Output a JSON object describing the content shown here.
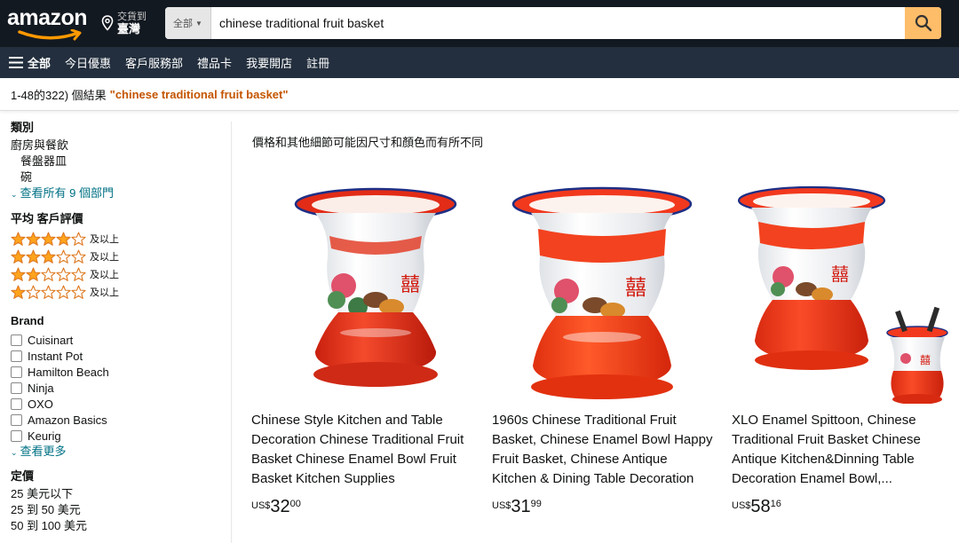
{
  "header": {
    "logo_text": "amazon",
    "deliver_line1": "交貨到",
    "deliver_line2": "臺灣",
    "search_scope": "全部",
    "search_value": "chinese traditional fruit basket"
  },
  "nav": {
    "all_label": "全部",
    "items": [
      "今日優惠",
      "客戶服務部",
      "禮品卡",
      "我要開店",
      "註冊"
    ]
  },
  "results": {
    "count_text": "1-48的322) 個結果",
    "query_text": "\"chinese traditional fruit basket\""
  },
  "sidebar": {
    "category_heading": "類別",
    "category_main": "廚房與餐飲",
    "category_subs": [
      "餐盤器皿",
      "碗"
    ],
    "category_more": "查看所有 9 個部門",
    "rating_heading": "平均 客戶評價",
    "ratings": [
      {
        "stars": 4,
        "label": "及以上"
      },
      {
        "stars": 3,
        "label": "及以上"
      },
      {
        "stars": 2,
        "label": "及以上"
      },
      {
        "stars": 1,
        "label": "及以上"
      }
    ],
    "brand_heading": "Brand",
    "brands": [
      "Cuisinart",
      "Instant Pot",
      "Hamilton Beach",
      "Ninja",
      "OXO",
      "Amazon Basics",
      "Keurig"
    ],
    "brand_more": "查看更多",
    "price_heading": "定價",
    "price_ranges": [
      "25 美元以下",
      "25 到 50 美元",
      "50 到 100 美元"
    ]
  },
  "main": {
    "notice": "價格和其他細節可能因尺寸和顏色而有所不同",
    "products": [
      {
        "title": "Chinese Style Kitchen and Table Decoration Chinese Traditional Fruit Basket Chinese Enamel Bowl Fruit Basket Kitchen Supplies",
        "currency": "US$",
        "whole": "32",
        "fraction": "00"
      },
      {
        "title": "1960s Chinese Traditional Fruit Basket, Chinese Enamel Bowl Happy Fruit Basket, Chinese Antique Kitchen & Dining Table Decoration",
        "currency": "US$",
        "whole": "31",
        "fraction": "99"
      },
      {
        "title": "XLO Enamel Spittoon, Chinese Traditional Fruit Basket Chinese Antique Kitchen&Dinning Table Decoration Enamel Bowl,...",
        "currency": "US$",
        "whole": "58",
        "fraction": "16"
      }
    ]
  },
  "colors": {
    "header_bg": "#131921",
    "nav_bg": "#232f3e",
    "search_button": "#febd69",
    "star": "#ffa41c",
    "link": "#007185",
    "query": "#c45500",
    "enamel_red": "#f2391e"
  },
  "icons": [
    "location-pin-icon",
    "search-icon",
    "hamburger-icon",
    "star-icon",
    "chevron-down-icon"
  ]
}
